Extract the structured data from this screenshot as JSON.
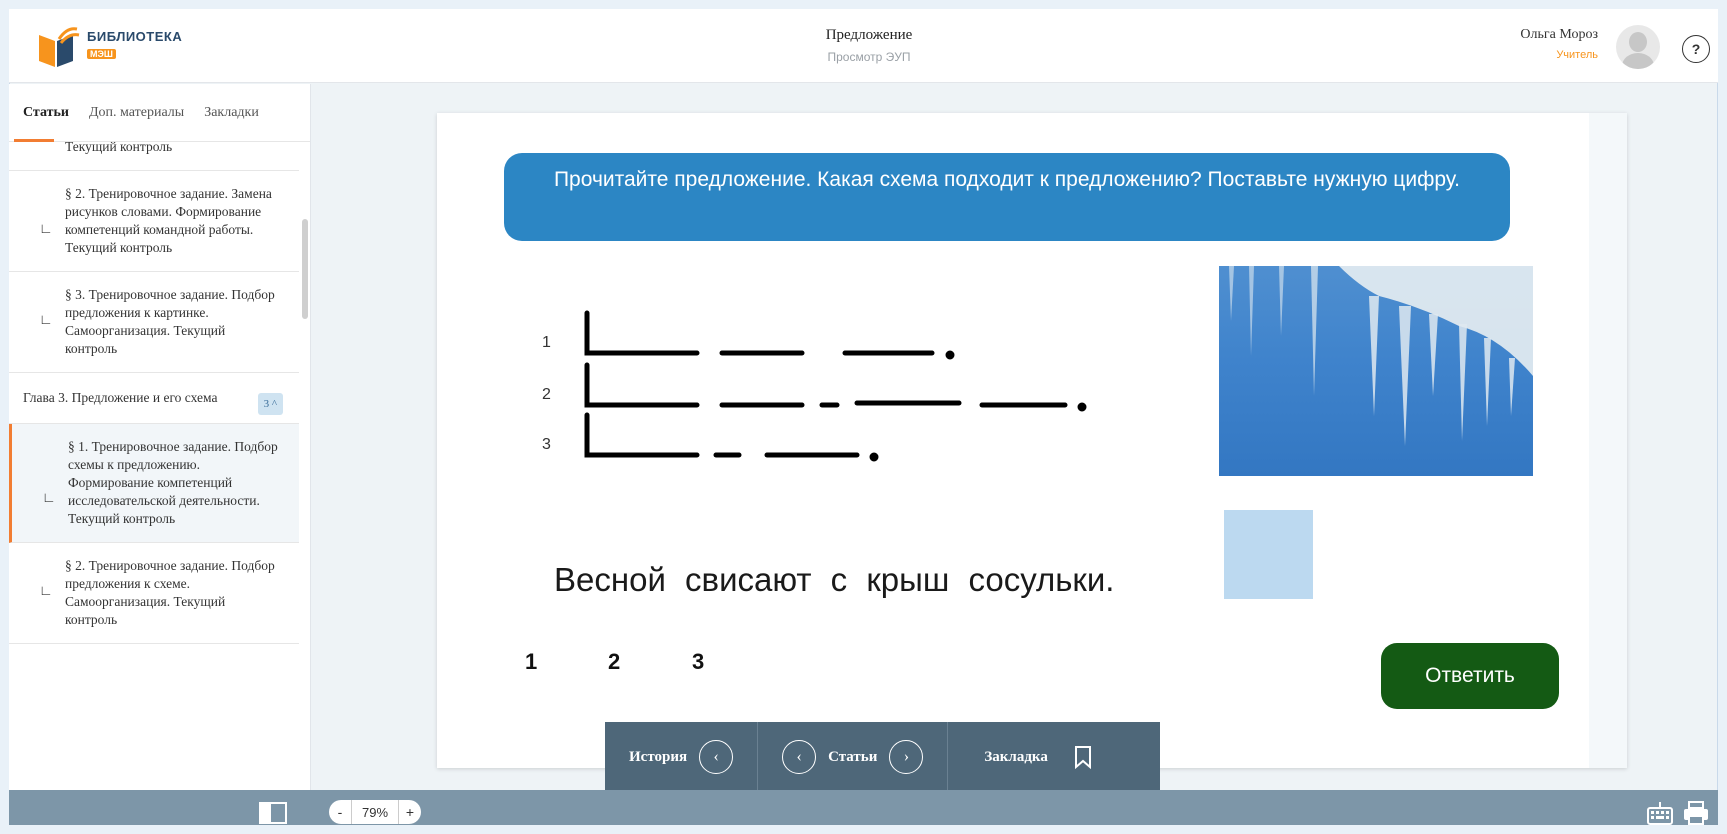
{
  "header": {
    "logo_title": "БИБЛИОТЕКА",
    "logo_badge": "МЭШ",
    "title": "Предложение",
    "subtitle": "Просмотр ЭУП",
    "user_name": "Ольга Мороз",
    "user_role": "Учитель",
    "help_label": "?"
  },
  "sidebar": {
    "tabs": [
      "Статьи",
      "Доп. материалы",
      "Закладки"
    ],
    "items": [
      {
        "text": "Текущий контроль"
      },
      {
        "text": "§ 2. Тренировочное задание. Замена рисунков словами. Формирование компетенций командной работы. Текущий контроль"
      },
      {
        "text": "§ 3. Тренировочное задание. Подбор предложения к картинке. Самоорганизация. Текущий контроль"
      }
    ],
    "chapter": {
      "text": "Глава 3. Предложение и его схема",
      "badge": "3 ^"
    },
    "items2": [
      {
        "text": "§ 1. Тренировочное задание. Подбор схемы к предложению. Формирование компетенций исследовательской деятельности. Текущий контроль"
      },
      {
        "text": "§ 2. Тренировочное задание. Подбор предложения к схеме. Самоорганизация. Текущий контроль"
      }
    ]
  },
  "task": {
    "instruction": "Прочитайте предложение. Какая схема подходит к предложению? Поставьте нужную цифру.",
    "scheme_labels": [
      "1",
      "2",
      "3"
    ],
    "sentence": "Весной свисают с крыш сосульки.",
    "options": [
      "1",
      "2",
      "3"
    ],
    "reply_button": "Ответить"
  },
  "floatnav": {
    "history": "История",
    "articles": "Статьи",
    "bookmark": "Закладка",
    "prev_glyph": "‹",
    "next_glyph": "›"
  },
  "bottombar": {
    "zoom_minus": "-",
    "zoom_value": "79%",
    "zoom_plus": "+"
  },
  "colors": {
    "accent_orange": "#f27d32",
    "instruction_blue": "#2c86c4",
    "reply_green": "#145a14",
    "nav_bg": "#4e6779",
    "bottombar_bg": "#7d96a8"
  }
}
